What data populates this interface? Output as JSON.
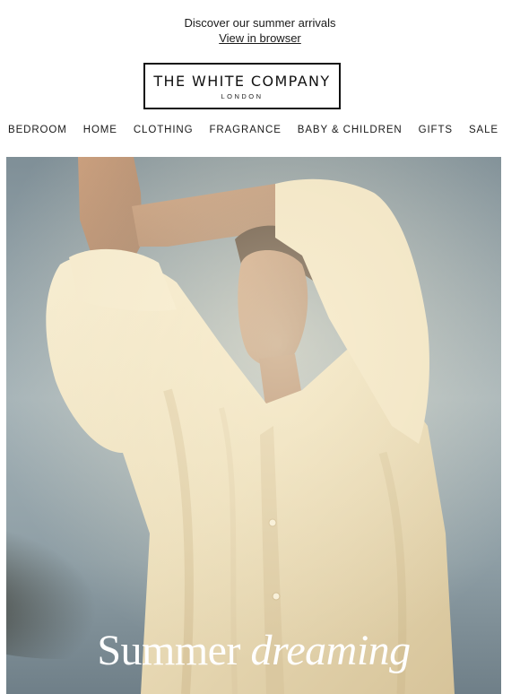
{
  "preheader": {
    "tagline": "Discover our summer arrivals",
    "view_link": "View in browser"
  },
  "brand": {
    "name": "THE WHITE COMPANY",
    "location": "LONDON"
  },
  "nav": {
    "items": [
      {
        "label": "BEDROOM"
      },
      {
        "label": "HOME"
      },
      {
        "label": "CLOTHING"
      },
      {
        "label": "FRAGRANCE"
      },
      {
        "label": "BABY & CHILDREN"
      },
      {
        "label": "GIFTS"
      },
      {
        "label": "SALE"
      }
    ]
  },
  "hero": {
    "headline_regular": "Summer",
    "headline_italic": "dreaming",
    "image_subject": "woman in linen shirt with arms raised against sea sky"
  },
  "colors": {
    "text": "#1a1a1a",
    "sky": "#8c9aa1",
    "linen": "#eadcb8",
    "skin": "#b98a69"
  }
}
